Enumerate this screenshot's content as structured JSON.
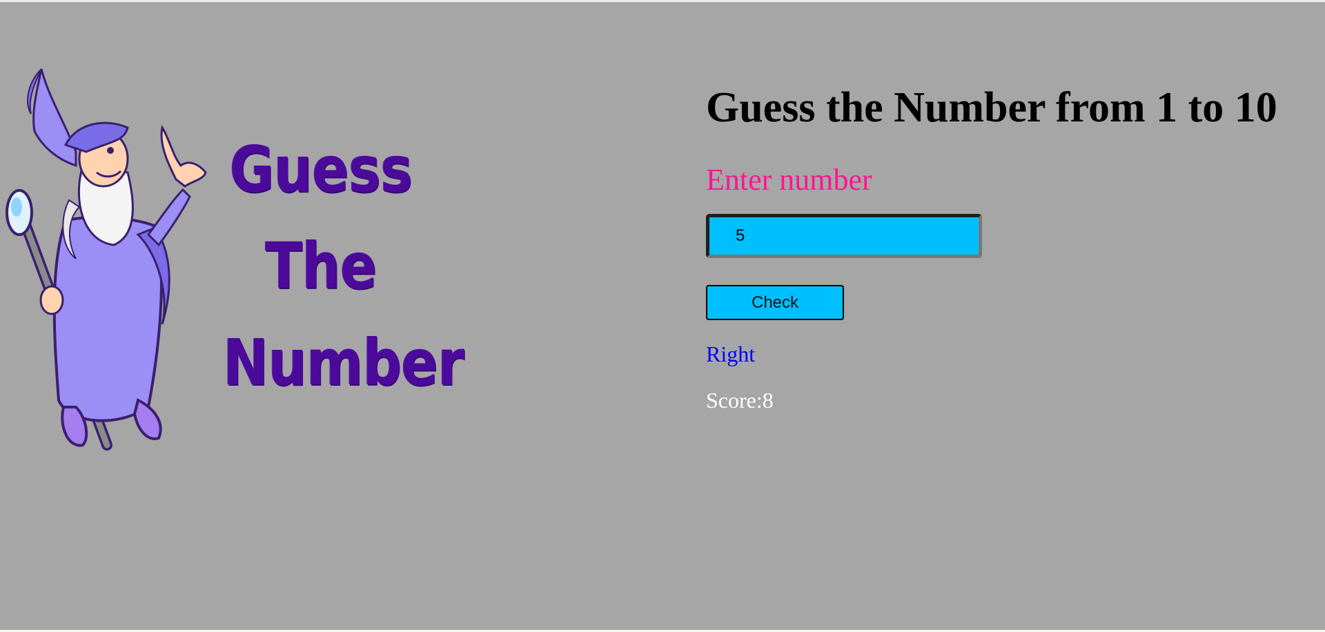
{
  "logo": {
    "words": [
      "Guess",
      "The",
      "Number"
    ],
    "mascot": "wizard-mascot",
    "accent_color": "#4b0a9a"
  },
  "game": {
    "title": "Guess the Number from 1 to 10",
    "prompt": "Enter number",
    "input_value": "5",
    "check_label": "Check",
    "result": "Right",
    "score": "Score:8"
  },
  "colors": {
    "background": "#a6a6a6",
    "input_background": "#00bfff",
    "prompt_color": "#ff1493",
    "result_color": "#0000ff",
    "score_color": "#ffffff"
  }
}
